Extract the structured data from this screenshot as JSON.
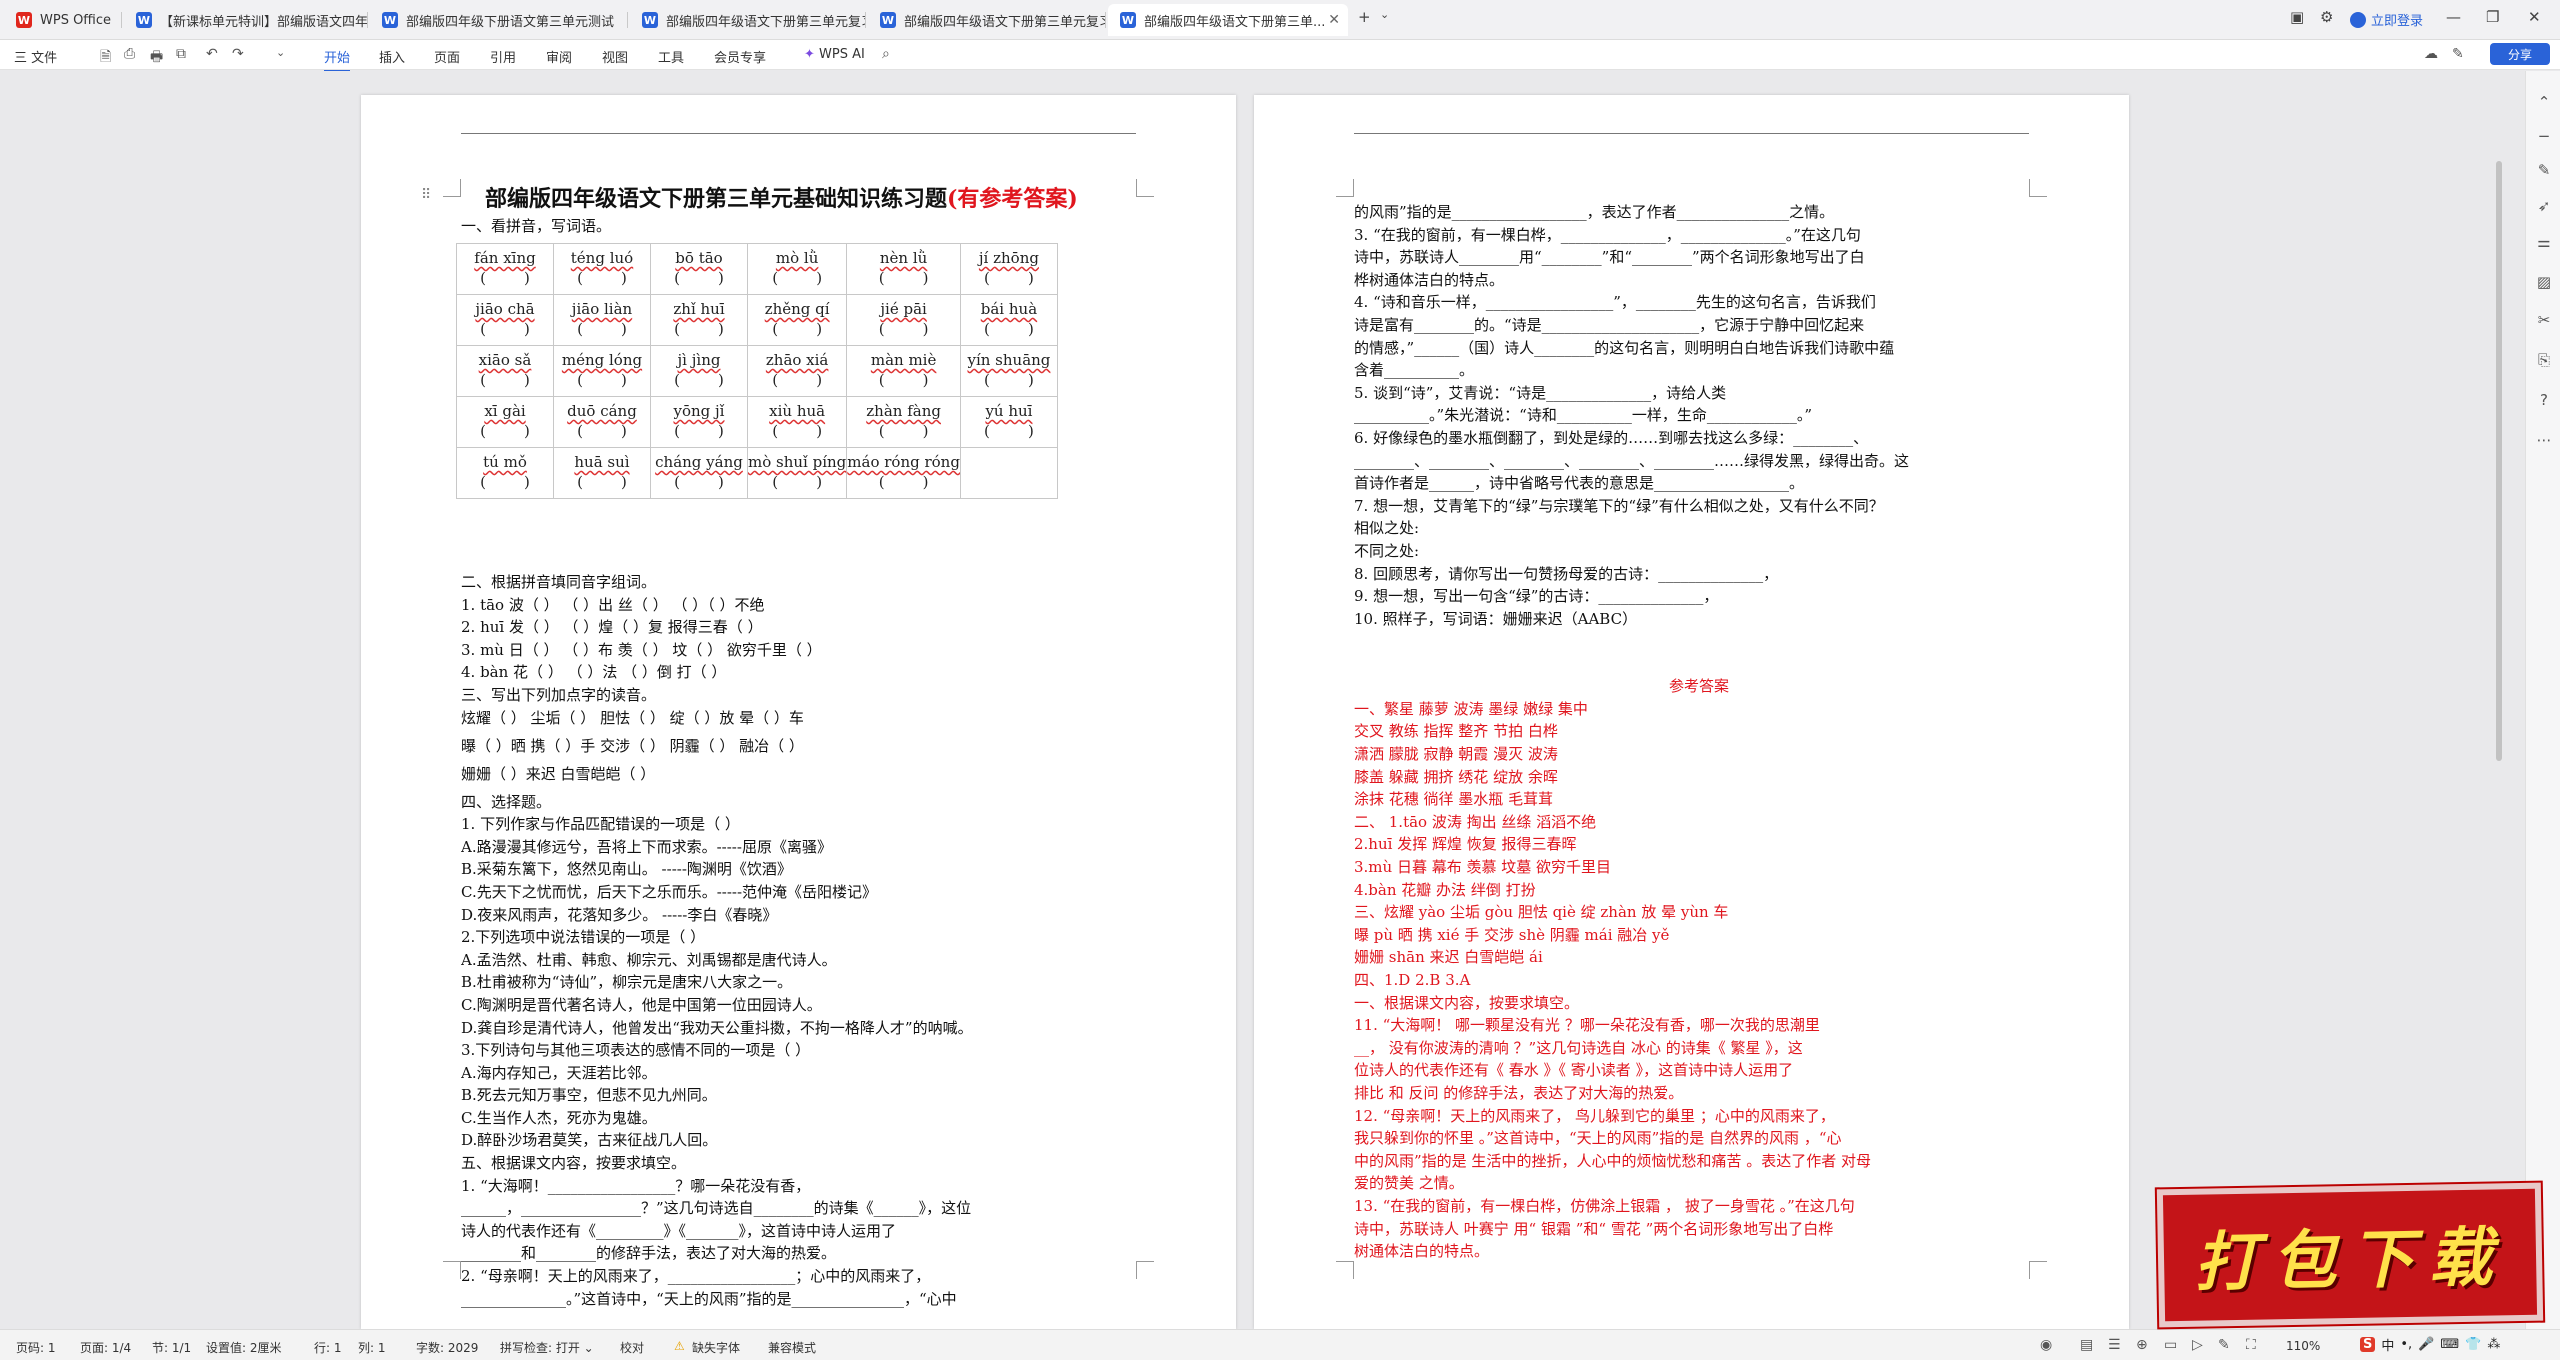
{
  "tabs": [
    {
      "label": "WPS Office",
      "icon_color": "#e0261c",
      "icon_letter": "W"
    },
    {
      "label": "【新课标单元特训】部编版语文四年",
      "icon_color": "#2a63d8",
      "icon_letter": "W"
    },
    {
      "label": "部编版四年级下册语文第三单元测试",
      "icon_color": "#2a63d8",
      "icon_letter": "W"
    },
    {
      "label": "部编版四年级语文下册第三单元复习",
      "icon_color": "#2a63d8",
      "icon_letter": "W"
    },
    {
      "label": "部编版四年级语文下册第三单元复习",
      "icon_color": "#2a63d8",
      "icon_letter": "W"
    },
    {
      "label": "部编版四年级语文下册第三单...",
      "icon_color": "#2a63d8",
      "icon_letter": "W"
    }
  ],
  "titlebar": {
    "login": "立即登录",
    "share": "分享"
  },
  "ribbon": {
    "file": "三 文件",
    "tabs": [
      "开始",
      "插入",
      "页面",
      "引用",
      "审阅",
      "视图",
      "工具",
      "会员专享"
    ],
    "ai": "WPS AI",
    "active_color": "#2a63d8"
  },
  "page1": {
    "title_main": "部编版四年级语文下册第三单元基础知识练习题",
    "title_red": "(有参考答案)",
    "section1": "一、看拼音，写词语。",
    "pinyin": [
      [
        "fán xīng",
        "téng luó",
        "bō tāo",
        "mò lǜ",
        "nèn lǜ",
        "jí zhōng"
      ],
      [
        "jiāo chā",
        "jiāo liàn",
        "zhǐ huī",
        "zhěng qí",
        "jié pāi",
        "bái huà"
      ],
      [
        "xiāo sǎ",
        "méng lóng",
        "jì jìng",
        "zhāo xiá",
        "màn miè",
        "yín shuāng"
      ],
      [
        "xī gài",
        "duō cáng",
        "yōng jǐ",
        "xiù huā",
        "zhàn fàng",
        "yú huī"
      ],
      [
        "tú mǒ",
        "huā suì",
        "cháng yáng",
        "mò shuǐ píng",
        "máo róng róng",
        ""
      ]
    ],
    "bracket": "(        )",
    "lines": [
      "二、根据拼音填同音字组词。",
      "1.  tāo     波（     ）    （     ）出  丝（     ）    （     ）（     ）不绝",
      "2.  huī  发（     ）    （     ）煌（     ）复  报得三春（     ）",
      "3. mù  日（     ）    （     ）布    羡（     ）    坟（     ）    欲穷千里（     ）",
      "4. bàn    花（     ）    （     ）法  （     ）倒  打（     ）",
      "三、写出下列加点字的读音。",
      "炫耀（     ）    尘垢（     ）    胆怯（     ）    绽（     ）放    晕（     ）车",
      "曝（     ）晒    携（     ）手    交涉（     ）    阴霾（     ）    融冶（     ）",
      "姗姗（     ）来迟      白雪皑皑（     ）",
      "四、选择题。",
      "1. 下列作家与作品匹配错误的一项是（         ）",
      "A.路漫漫其修远兮，吾将上下而求索。-----屈原《离骚》",
      "B.采菊东篱下，悠然见南山。              -----陶渊明《饮酒》",
      "C.先天下之忧而忧，后天下之乐而乐。-----范仲淹《岳阳楼记》",
      "D.夜来风雨声，花落知多少。              -----李白《春晓》",
      "2.下列选项中说法错误的一项是（       ）",
      "A.孟浩然、杜甫、韩愈、柳宗元、刘禹锡都是唐代诗人。",
      "B.杜甫被称为“诗仙”，柳宗元是唐宋八大家之一。",
      "C.陶渊明是晋代著名诗人，他是中国第一位田园诗人。",
      "D.龚自珍是清代诗人，他曾发出“我劝天公重抖擞，不拘一格降人才”的呐喊。",
      "3.下列诗句与其他三项表达的感情不同的一项是（        ）",
      "A.海内存知己，天涯若比邻。",
      "B.死去元知万事空，但悲不见九州同。",
      "C.生当作人杰，死亦为鬼雄。",
      "D.醉卧沙场君莫笑，古来征战几人回。",
      "五、根据课文内容，按要求填空。",
      "1. “大海啊！_________________？哪一朵花没有香，",
      "______，________________？”这几句诗选自________的诗集《______》，这位",
      "诗人的代表作还有《_________》《_______》，这首诗中诗人运用了",
      "________和________的修辞手法，表达了对大海的热爱。",
      "2. “母亲啊！天上的风雨来了，_________________；心中的风雨来了，",
      "______________。”这首诗中，“天上的风雨”指的是_______________，“心中"
    ]
  },
  "page2": {
    "lines": [
      "的风雨”指的是__________________，表达了作者_______________之情。",
      "3. “在我的窗前，有一棵白桦，______________，______________。”在这几句",
      "诗中，苏联诗人________用“________”和“________”两个名词形象地写出了白",
      "桦树通体洁白的特点。",
      "4. “诗和音乐一样，_________________”，________先生的这句名言，告诉我们",
      "诗是富有________的。“诗是_____________________，它源于宁静中回忆起来",
      "的情感，”______（国）诗人________的这句名言，则明明白白地告诉我们诗歌中蕴",
      "含着__________。",
      "5. 谈到“诗”，艾青说：“诗是______________，诗给人类",
      "__________。”朱光潜说：“诗和__________一样，生命____________。”",
      "6. 好像绿色的墨水瓶倒翻了，到处是绿的……到哪去找这么多绿：________、",
      "________、________、________、________、________……绿得发黑，绿得出奇。这",
      "首诗作者是______，诗中省略号代表的意思是__________________。",
      "7. 想一想，艾青笔下的“绿”与宗璞笔下的“绿”有什么相似之处，又有什么不同？",
      "相似之处:",
      "不同之处:",
      "8. 回顾思考，请你写出一句赞扬母爱的古诗：______________，",
      "9. 想一想，写出一句含“绿”的古诗：______________，",
      "10. 照样子，写词语：姗姗来迟（AABC）"
    ],
    "answer_title": "参考答案",
    "answers": [
      "一、繁星   藤萝   波涛  墨绿  嫩绿  集中",
      "交叉  教练   指挥  整齐  节拍  白桦",
      "潇洒  朦胧  寂静  朝霞  漫灭   波涛",
      "膝盖   躲藏   拥挤   绣花   绽放  余晖",
      "涂抹   花穗   徜徉  墨水瓶    毛茸茸",
      "二、  1.tāo   波涛    掏出  丝绦    滔滔不绝",
      "2.huī  发挥    辉煌  恢复    报得三春晖",
      "3.mù  日暮    幕布    羡慕    坟墓    欲穷千里目",
      "4.bàn  花瓣   办法    绊倒    打扮",
      "三、炫耀  yào  尘垢  gòu    胆怯  qiè     绽  zhàn 放     晕  yùn 车",
      "曝  pù 晒    携  xié 手     交涉  shè   阴霾  mái     融冶  yě",
      "姗姗  shān 来迟        白雪皑皑  ái",
      "四、1.D          2.B        3.A",
      "一、根据课文内容，按要求填空。",
      "11. “大海啊！  哪一颗星没有光  ？哪一朵花没有香，哪一次我的思潮里",
      "__，        没有你波涛的清响      ？”这几句诗选自   冰心   的诗集《   繁星   》，这",
      "位诗人的代表作还有《   春水   》《   寄小读者   》，这首诗中诗人运用了",
      "    排比         和     反问       的修辞手法，表达了对大海的热爱。",
      "12. “母亲啊！天上的风雨来了，    鸟儿躲到它的巢里    ；心中的风雨来了，",
      "  我只躲到你的怀里  。”这首诗中，“天上的风雨”指的是  自然界的风雨      ，“心",
      "中的风雨”指的是  生活中的挫折，人心中的烦恼忧愁和痛苦    。表达了作者    对母",
      "爱的赞美    之情。",
      "13. “在我的窗前，有一棵白桦，仿佛涂上银霜      ，  披了一身雪花     。”在这几句",
      "诗中，苏联诗人  叶赛宁   用“    银霜      ”和“  雪花     ”两个名词形象地写出了白桦",
      "树通体洁白的特点。"
    ],
    "answer_color": "#e0161e"
  },
  "statusbar": {
    "page_num": "页码: 1",
    "pages": "页面: 1/4",
    "section": "节: 1/1",
    "setting": "设置值: 2厘米",
    "row": "行: 1",
    "col": "列: 1",
    "words": "字数: 2029",
    "spell": "拼写检查: 打开 ⌄",
    "proof": "校对",
    "missing_font": "缺失字体",
    "compat": "兼容模式",
    "zoom": "110%"
  },
  "banner": {
    "text": "打包下载"
  },
  "tray": {
    "label": "中"
  }
}
